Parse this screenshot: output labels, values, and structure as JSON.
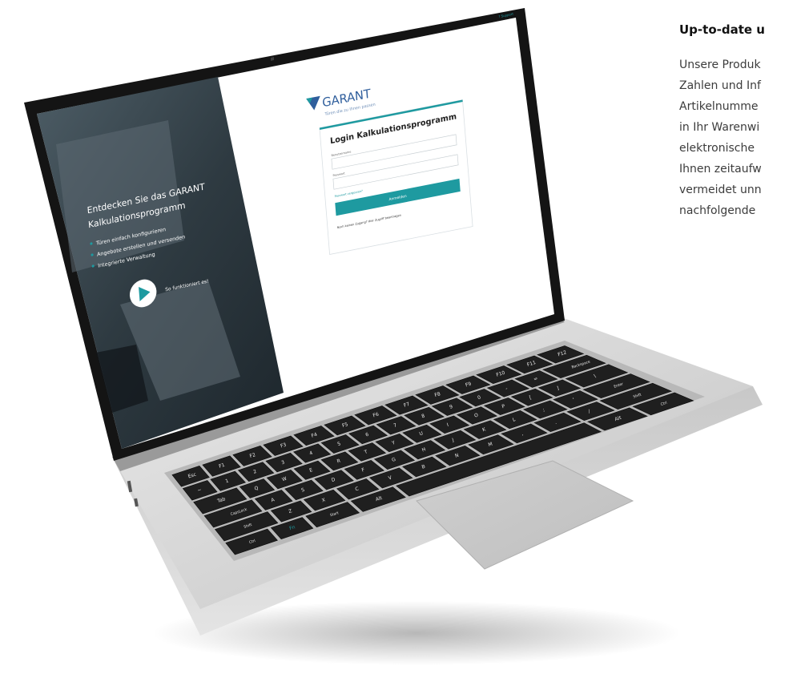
{
  "side_text": {
    "heading": "Up-to-date u",
    "lines": [
      "Unsere Produk",
      "Zahlen und Inf",
      "Artikelnumme",
      "in Ihr Warenwi",
      "elektronische",
      "Ihnen zeitaufw",
      "vermeidet unn",
      "nachfolgende"
    ]
  },
  "laptop_screen": {
    "hero": {
      "title_line1": "Entdecken Sie das GARANT",
      "title_line2": "Kalkulationsprogramm",
      "bullets": [
        "Türen einfach konfigurieren",
        "Angebote erstellen und versenden",
        "Integrierte Verwaltung"
      ],
      "video_label": "So funktioniert es!"
    },
    "support_link": "? Support",
    "brand": {
      "name": "GARANT",
      "tagline": "Türen die zu Ihnen passen"
    },
    "login": {
      "title": "Login Kalkulationsprogramm",
      "username_label": "Benutzername",
      "password_label": "Passwort",
      "forgot_link": "Passwort vergessen?",
      "submit_label": "Anmelden",
      "footer_text": "Noch keinen Zugang? Hier Zugriff beantragen"
    }
  },
  "keyboard": {
    "fn_label": "Fn",
    "row_numbers": [
      "Esc",
      "F1",
      "F2",
      "F3",
      "F4",
      "F5",
      "F6",
      "F7",
      "F8",
      "F9",
      "F10",
      "F11",
      "F12"
    ],
    "row1": [
      "~",
      "1",
      "2",
      "3",
      "4",
      "5",
      "6",
      "7",
      "8",
      "9",
      "0",
      "-",
      "=",
      "Backspace"
    ],
    "row2": [
      "Tab",
      "Q",
      "W",
      "E",
      "R",
      "T",
      "Y",
      "U",
      "I",
      "O",
      "P",
      "[",
      "]",
      "\\"
    ],
    "row3": [
      "CapsLock",
      "A",
      "S",
      "D",
      "F",
      "G",
      "H",
      "J",
      "K",
      "L",
      ";",
      "'",
      "Enter"
    ],
    "row4": [
      "Shift",
      "Z",
      "X",
      "C",
      "V",
      "B",
      "N",
      "M",
      ",",
      ".",
      "/",
      "Shift"
    ],
    "row5": [
      "Ctrl",
      "Fn",
      "Start",
      "Alt",
      "",
      "Alt",
      "Ctrl"
    ]
  },
  "colors": {
    "accent": "#1e9aa0",
    "brand_blue": "#2f5e9c",
    "hero_overlay": "#24323b",
    "bezel": "#141414",
    "chassis": "#d9d9d9",
    "text_dark": "#222222"
  }
}
